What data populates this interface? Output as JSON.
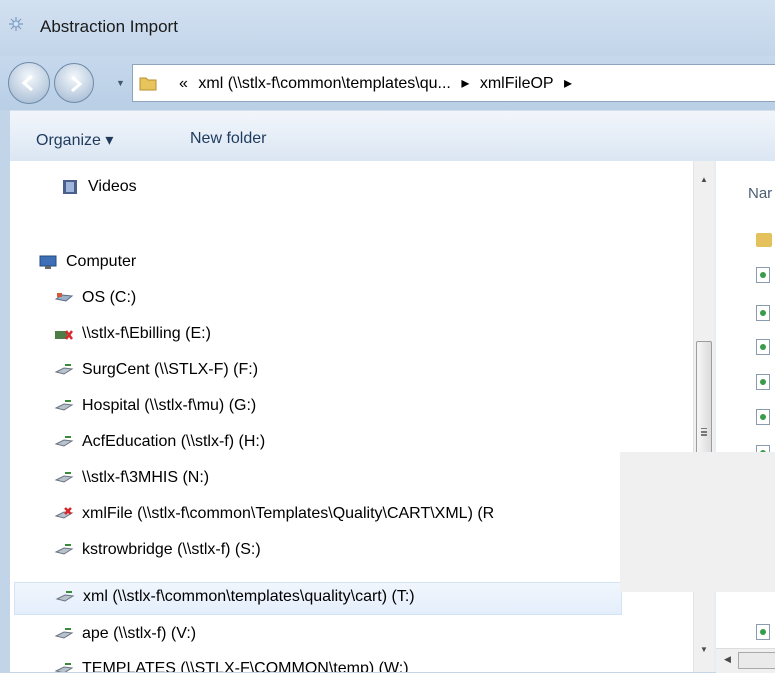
{
  "window": {
    "title": "Abstraction Import"
  },
  "address_bar": {
    "overflow_chevron": "«",
    "segments": [
      "xml (\\\\stlx-f\\common\\templates\\qu...",
      "xmlFileOP"
    ],
    "separator": "▸"
  },
  "toolbar": {
    "organize_label": "Organize ▾",
    "new_folder_label": "New folder"
  },
  "nav_pane": {
    "items": [
      {
        "label": "Videos",
        "icon": "videos-icon"
      },
      {
        "label": "Computer",
        "icon": "computer-icon"
      },
      {
        "label": "OS (C:)",
        "icon": "local-drive-icon"
      },
      {
        "label": "\\\\stlx-f\\Ebilling (E:)",
        "icon": "disconnected-drive-icon"
      },
      {
        "label": "SurgCent (\\\\STLX-F) (F:)",
        "icon": "network-drive-icon"
      },
      {
        "label": "Hospital (\\\\stlx-f\\mu) (G:)",
        "icon": "network-drive-icon"
      },
      {
        "label": "AcfEducation (\\\\stlx-f) (H:)",
        "icon": "network-drive-icon"
      },
      {
        "label": "\\\\stlx-f\\3MHIS (N:)",
        "icon": "network-drive-icon"
      },
      {
        "label": "xmlFile (\\\\stlx-f\\common\\Templates\\Quality\\CART\\XML) (R",
        "icon": "disconnected-network-drive-icon"
      },
      {
        "label": "kstrowbridge (\\\\stlx-f) (S:)",
        "icon": "network-drive-icon"
      },
      {
        "label": "xml (\\\\stlx-f\\common\\templates\\quality\\cart) (T:)",
        "icon": "network-drive-icon",
        "selected": true
      },
      {
        "label": "ape (\\\\stlx-f) (V:)",
        "icon": "network-drive-icon"
      },
      {
        "label": "TEMPLATES (\\\\STLX-F\\COMMON\\temp) (W:)",
        "icon": "network-drive-icon"
      }
    ]
  },
  "file_pane": {
    "column_header": "Nar"
  },
  "colors": {
    "selection": "#e4eefb",
    "toolbar_text": "#1e3b5e",
    "frame": "#c5d5e6"
  }
}
